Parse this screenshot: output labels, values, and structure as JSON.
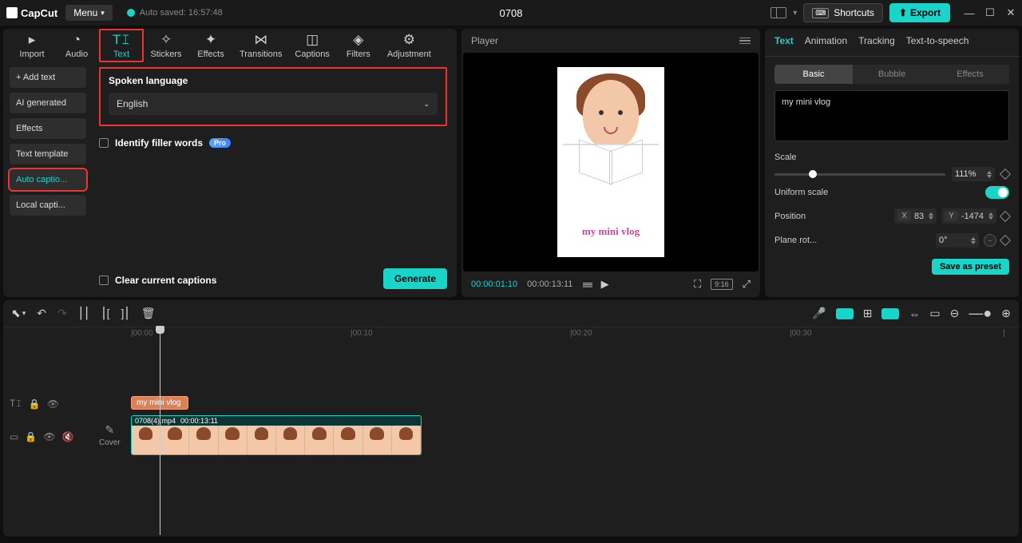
{
  "app": {
    "name": "CapCut",
    "menu": "Menu",
    "autosave": "Auto saved: 16:57:48",
    "project": "0708",
    "shortcuts": "Shortcuts",
    "export": "Export"
  },
  "tabs": {
    "import": "Import",
    "audio": "Audio",
    "text": "Text",
    "stickers": "Stickers",
    "effects": "Effects",
    "transitions": "Transitions",
    "captions": "Captions",
    "filters": "Filters",
    "adjustment": "Adjustment"
  },
  "sidebar": {
    "add_text": "Add text",
    "ai_generated": "AI generated",
    "effects": "Effects",
    "text_template": "Text template",
    "auto_captions": "Auto captio...",
    "local_captions": "Local capti..."
  },
  "form": {
    "spoken_language_label": "Spoken language",
    "language_value": "English",
    "identify_filler": "Identify filler words",
    "pro": "Pro",
    "clear_captions": "Clear current captions",
    "generate": "Generate"
  },
  "player": {
    "title": "Player",
    "current": "00:00:01:10",
    "duration": "00:00:13:11",
    "overlay": "my mini vlog",
    "ratio": "9:16"
  },
  "right": {
    "tabs": {
      "text": "Text",
      "animation": "Animation",
      "tracking": "Tracking",
      "tts": "Text-to-speech"
    },
    "sub": {
      "basic": "Basic",
      "bubble": "Bubble",
      "effects": "Effects"
    },
    "text_value": "my mini vlog",
    "scale_label": "Scale",
    "scale_value": "111%",
    "uniform_label": "Uniform scale",
    "position_label": "Position",
    "x_label": "X",
    "x_value": "83",
    "y_label": "Y",
    "y_value": "-1474",
    "rotation_label": "Plane rot...",
    "rotation_value": "0°",
    "save_preset": "Save as preset"
  },
  "timeline": {
    "ticks": [
      "|00:00",
      "|00:10",
      "|00:20",
      "|00:30",
      "|"
    ],
    "text_clip": "my mini vlog",
    "video_name": "0708(4).mp4",
    "video_dur": "00:00:13:11",
    "cover": "Cover"
  }
}
